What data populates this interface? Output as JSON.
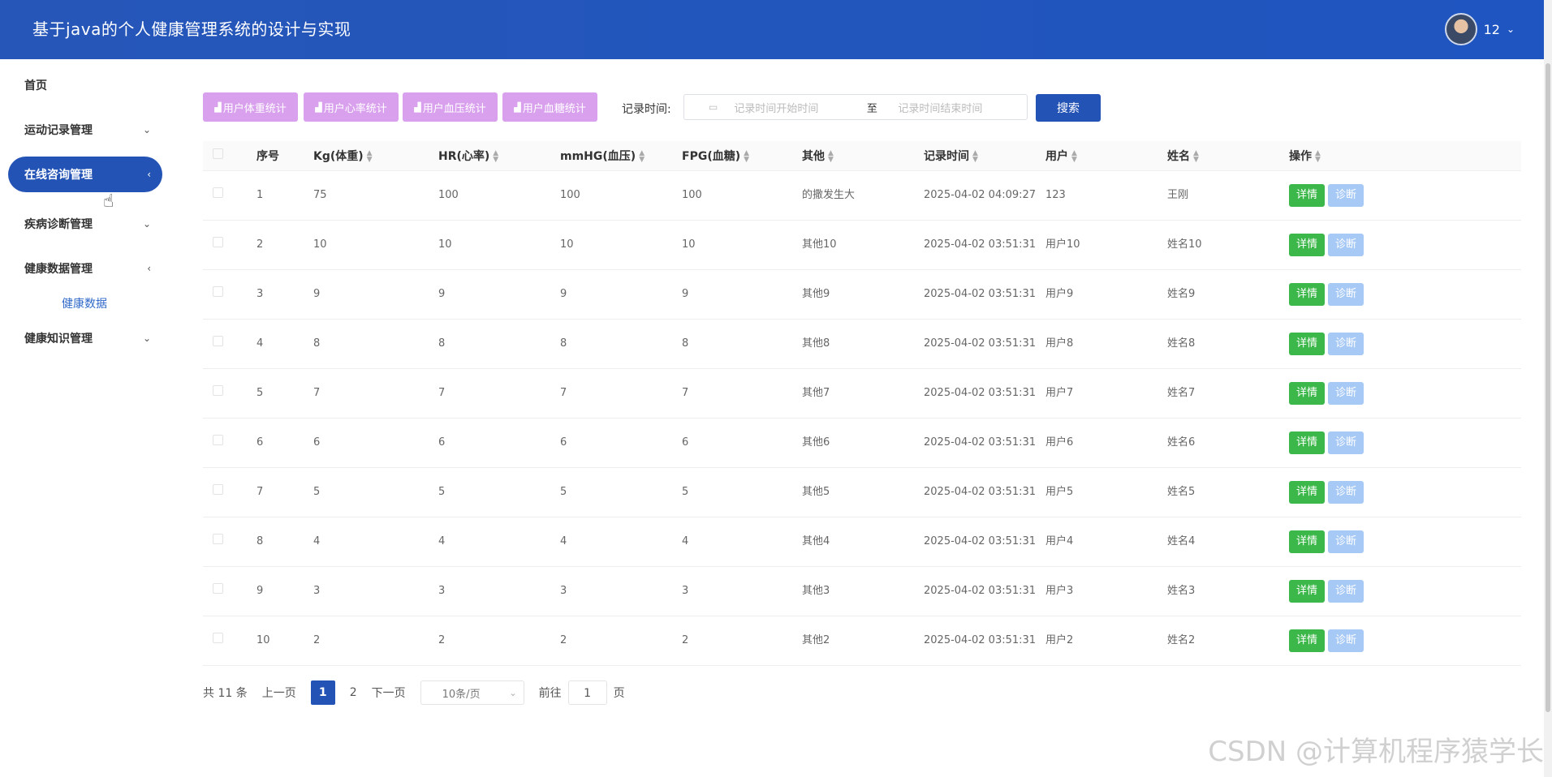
{
  "header": {
    "title": "基于java的个人健康管理系统的设计与实现",
    "username": "12"
  },
  "sidebar": {
    "items": [
      {
        "label": "首页",
        "arrow": ""
      },
      {
        "label": "运动记录管理",
        "arrow": "⌄"
      },
      {
        "label": "在线咨询管理",
        "arrow": "‹"
      },
      {
        "label": "疾病诊断管理",
        "arrow": "⌄"
      },
      {
        "label": "健康数据管理",
        "arrow": "‹"
      },
      {
        "label": "健康知识管理",
        "arrow": "⌄"
      }
    ],
    "subitem": "健康数据"
  },
  "toolbar": {
    "stat_buttons": [
      "用户体重统计",
      "用户心率统计",
      "用户血压统计",
      "用户血糖统计"
    ],
    "date_label": "记录时间:",
    "start_placeholder": "记录时间开始时间",
    "separator": "至",
    "end_placeholder": "记录时间结束时间",
    "search_label": "搜索"
  },
  "table": {
    "headers": [
      "序号",
      "Kg(体重)",
      "HR(心率)",
      "mmHG(血压)",
      "FPG(血糖)",
      "其他",
      "记录时间",
      "用户",
      "姓名",
      "操作"
    ],
    "detail_label": "详情",
    "diag_label": "诊断",
    "rows": [
      [
        "1",
        "75",
        "100",
        "100",
        "100",
        "的撒发生大",
        "2025-04-02 04:09:27",
        "123",
        "王刚"
      ],
      [
        "2",
        "10",
        "10",
        "10",
        "10",
        "其他10",
        "2025-04-02 03:51:31",
        "用户10",
        "姓名10"
      ],
      [
        "3",
        "9",
        "9",
        "9",
        "9",
        "其他9",
        "2025-04-02 03:51:31",
        "用户9",
        "姓名9"
      ],
      [
        "4",
        "8",
        "8",
        "8",
        "8",
        "其他8",
        "2025-04-02 03:51:31",
        "用户8",
        "姓名8"
      ],
      [
        "5",
        "7",
        "7",
        "7",
        "7",
        "其他7",
        "2025-04-02 03:51:31",
        "用户7",
        "姓名7"
      ],
      [
        "6",
        "6",
        "6",
        "6",
        "6",
        "其他6",
        "2025-04-02 03:51:31",
        "用户6",
        "姓名6"
      ],
      [
        "7",
        "5",
        "5",
        "5",
        "5",
        "其他5",
        "2025-04-02 03:51:31",
        "用户5",
        "姓名5"
      ],
      [
        "8",
        "4",
        "4",
        "4",
        "4",
        "其他4",
        "2025-04-02 03:51:31",
        "用户4",
        "姓名4"
      ],
      [
        "9",
        "3",
        "3",
        "3",
        "3",
        "其他3",
        "2025-04-02 03:51:31",
        "用户3",
        "姓名3"
      ],
      [
        "10",
        "2",
        "2",
        "2",
        "2",
        "其他2",
        "2025-04-02 03:51:31",
        "用户2",
        "姓名2"
      ]
    ]
  },
  "pager": {
    "total": "共 11 条",
    "prev": "上一页",
    "page1": "1",
    "page2": "2",
    "next": "下一页",
    "page_size": "10条/页",
    "goto": "前往",
    "goto_value": "1",
    "page_suffix": "页"
  },
  "watermark": "CSDN @计算机程序猿学长",
  "colors": {
    "header": "#2453b6",
    "stat_button": "#d9a0ee",
    "detail": "#3cb84a",
    "diagnose": "#a7c9f5"
  }
}
